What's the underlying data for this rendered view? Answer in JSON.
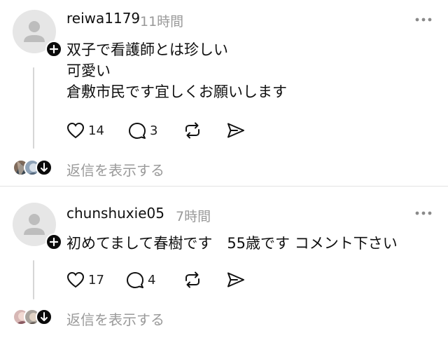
{
  "posts": [
    {
      "username": "reiwa1179",
      "time": "11時間",
      "lines": [
        "双子で看護師とは珍しい",
        "可愛い",
        "倉敷市民です宜しくお願いします"
      ],
      "like_count": "14",
      "reply_count": "3",
      "show_replies": "返信を表示する"
    },
    {
      "username": "chunshuxie05",
      "time": "7時間",
      "lines": [
        "初めてまして春樹です　55歳です コメント下さい"
      ],
      "like_count": "17",
      "reply_count": "4",
      "show_replies": "返信を表示する"
    }
  ],
  "icons": {
    "avatar": "default-avatar-icon",
    "follow": "plus-icon",
    "more": "more-horizontal-icon",
    "like": "heart-icon",
    "reply": "comment-icon",
    "repost": "repost-icon",
    "share": "send-icon",
    "expand": "arrow-down-icon"
  },
  "colors": {
    "text": "#101010",
    "muted": "#999999",
    "avatar_bg": "#e6e6e6",
    "divider": "#e2e2e2"
  }
}
